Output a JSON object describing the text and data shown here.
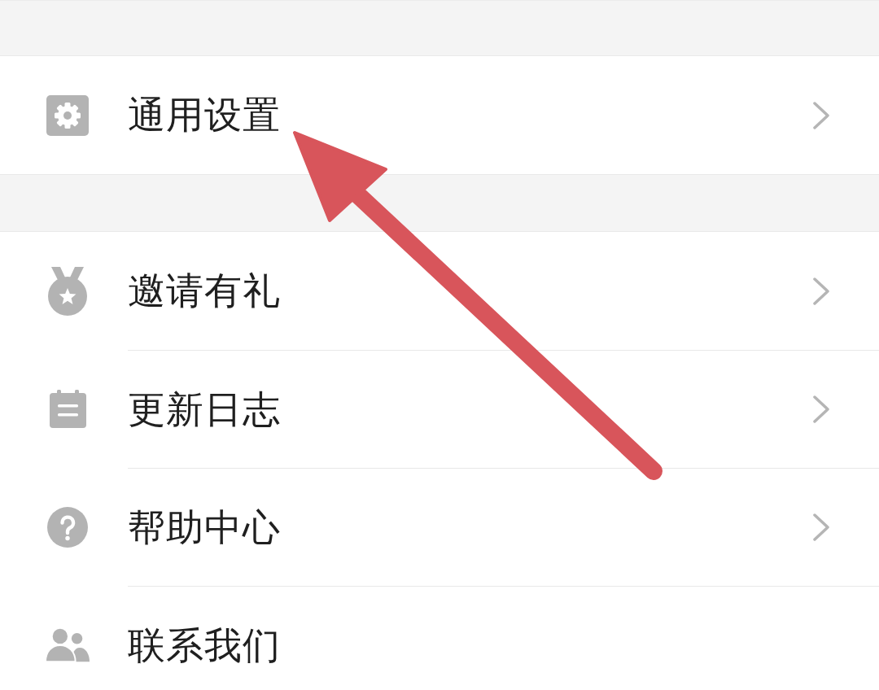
{
  "sections": [
    {
      "items": [
        {
          "kind": "settings",
          "label": "通用设置",
          "chevron": true
        }
      ]
    },
    {
      "items": [
        {
          "kind": "invite",
          "label": "邀请有礼",
          "chevron": true
        },
        {
          "kind": "changelog",
          "label": "更新日志",
          "chevron": true
        },
        {
          "kind": "help",
          "label": "帮助中心",
          "chevron": true
        },
        {
          "kind": "contact",
          "label": "联系我们",
          "chevron": false
        }
      ]
    }
  ]
}
